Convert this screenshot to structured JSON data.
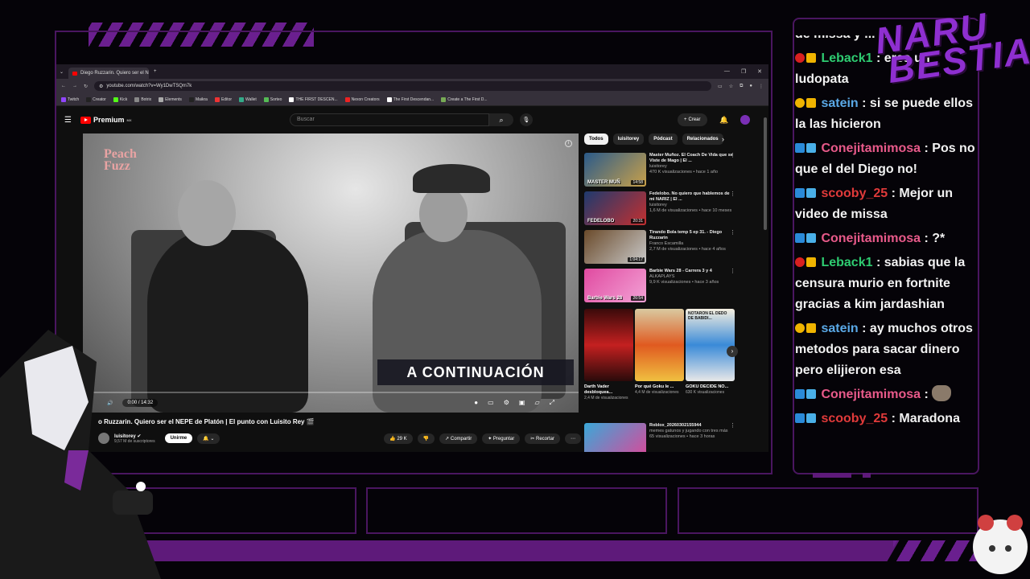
{
  "browser": {
    "tab_title": "Diego Ruzzarin. Quiero ser el N",
    "url": "youtube.com/watch?v=Wy1DwTSQm7k",
    "bookmarks": [
      "Twitch",
      "Creator",
      "Kick",
      "Botrix",
      "Elements",
      "Maikra",
      "Editor",
      "Wallet",
      "Sorteo",
      "THE FIRST DESCEN...",
      "Nexon Creators",
      "The First Descendan...",
      "Create a The First D..."
    ]
  },
  "youtube": {
    "logo": "Premium",
    "logo_region": "MX",
    "search_placeholder": "Buscar",
    "create_label": "Crear",
    "video": {
      "watermark": "Peach\nFuzz",
      "overlay_text": "A CONTINUACIÓN",
      "time": "0:00 / 14:32",
      "title": "o Ruzzarin. Quiero ser el NEPE de Platón | El punto con Luisito Rey 🎬",
      "channel": "luisitorey",
      "subscribers": "9,57 M de suscriptores",
      "join_label": "Unirme",
      "likes": "29 K",
      "share_label": "Compartir",
      "ask_label": "Preguntar",
      "clip_label": "Recortar"
    },
    "chips": [
      "Todos",
      "luisitorey",
      "Pódcast",
      "Relacionados"
    ],
    "recommendations": [
      {
        "title": "Master Muñoz. El Coach De Vida que se Viste de Mago | El ...",
        "channel": "luisitorey",
        "meta": "470 K visualizaciones • hace 1 año",
        "duration": "14:58",
        "thumb_text": "MASTER MUÑ"
      },
      {
        "title": "Fedelobo. No quiero que hablemos de mi NARIZ | El ...",
        "channel": "luisitorey",
        "meta": "1,6 M de visualizaciones • hace 10 meses",
        "duration": "20:31",
        "thumb_text": "FEDELOBO"
      },
      {
        "title": "Tirando Bola temp 5 ep 31. - Diego Ruzzarin",
        "channel": "Franco Escamilla",
        "meta": "2,7 M de visualizaciones • hace 4 años",
        "duration": "1:04:17",
        "thumb_text": ""
      },
      {
        "title": "Barbie Wars 28 - Carrera 3 y 4",
        "channel": "ALKAPLAYS",
        "meta": "9,9 K visualizaciones • hace 3 años",
        "duration": "26:54",
        "thumb_text": "Barbie Wars 28"
      }
    ],
    "shorts": [
      {
        "title": "Darth Vader desbloquea...",
        "meta": "2,4 M de visualizaciones"
      },
      {
        "title": "Por qué Goku le ...",
        "meta": "4,4 M de visualizaciones"
      },
      {
        "title": "GOKU DECIDE NO...",
        "meta": "630 K visualizaciones",
        "thumb_text": "NOTARON EL DEDO DE BABIDI..."
      }
    ],
    "last_rec": {
      "title": "Roblox_20260302155944",
      "channel": "memes gatunos y jugando con tres más",
      "meta": "65 visualizaciones • hace 3 horas"
    }
  },
  "chat": {
    "messages": [
      {
        "user": "",
        "text": "de missa y ... a",
        "color": "#f2f2f2",
        "badge": ""
      },
      {
        "user": "Leback1",
        "text": "eres un ludopata",
        "color": "#2ecc71",
        "badge": "red"
      },
      {
        "user": "satein",
        "text": "si se puede ellos la las hicieron",
        "color": "#5aa8e6",
        "badge": "gold"
      },
      {
        "user": "Conejitamimosa",
        "text": "Pos no que el del Diego no!",
        "color": "#e85a8a",
        "badge": "blue"
      },
      {
        "user": "scooby_25",
        "text": "Mejor un video de missa",
        "color": "#e03a3a",
        "badge": "blue"
      },
      {
        "user": "Conejitamimosa",
        "text": "?*",
        "color": "#e85a8a",
        "badge": "blue"
      },
      {
        "user": "Leback1",
        "text": "sabias que la censura murio en fortnite gracias a kim jardashian",
        "color": "#2ecc71",
        "badge": "red"
      },
      {
        "user": "satein",
        "text": "ay muchos otros metodos para sacar dinero pero elijieron esa",
        "color": "#5aa8e6",
        "badge": "gold"
      },
      {
        "user": "Conejitamimosa",
        "text": "",
        "color": "#e85a8a",
        "badge": "blue",
        "emote": true
      },
      {
        "user": "scooby_25",
        "text": "Maradona",
        "color": "#e03a3a",
        "badge": "blue"
      }
    ]
  },
  "overlay": {
    "brand_line1": "NARU",
    "brand_line2": "BESTIA",
    "brand_color": "#8e2fd0"
  }
}
